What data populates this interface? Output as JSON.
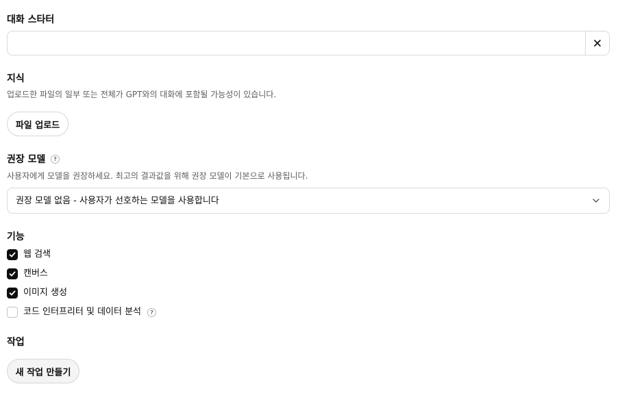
{
  "conversation_starters": {
    "title": "대화 스타터",
    "input_value": "",
    "input_placeholder": ""
  },
  "knowledge": {
    "title": "지식",
    "description": "업로드한 파일의 일부 또는 전체가 GPT와의 대화에 포함될 가능성이 있습니다.",
    "upload_label": "파일 업로드"
  },
  "recommended_model": {
    "title": "권장 모델",
    "description": "사용자에게 모델을 권장하세요. 최고의 결과값을 위해 권장 모델이 기본으로 사용됩니다.",
    "selected": "권장 모델 없음 - 사용자가 선호하는 모델을 사용합니다",
    "help_glyph": "?"
  },
  "capabilities": {
    "title": "기능",
    "items": [
      {
        "label": "웹 검색",
        "checked": true
      },
      {
        "label": "캔버스",
        "checked": true
      },
      {
        "label": "이미지 생성",
        "checked": true
      },
      {
        "label": "코드 인터프리터 및 데이터 분석",
        "checked": false,
        "has_help": true
      }
    ],
    "help_glyph": "?"
  },
  "actions": {
    "title": "작업",
    "create_label": "새 작업 만들기"
  },
  "colors": {
    "text": "#0d0d0d",
    "muted": "#5d5d5d",
    "border": "#d9d9d9",
    "checkbox_checked": "#0d0d0d"
  },
  "icons": {
    "clear": "close-icon",
    "select": "chevron-down-icon",
    "check": "check-icon",
    "help": "question-mark-icon"
  }
}
